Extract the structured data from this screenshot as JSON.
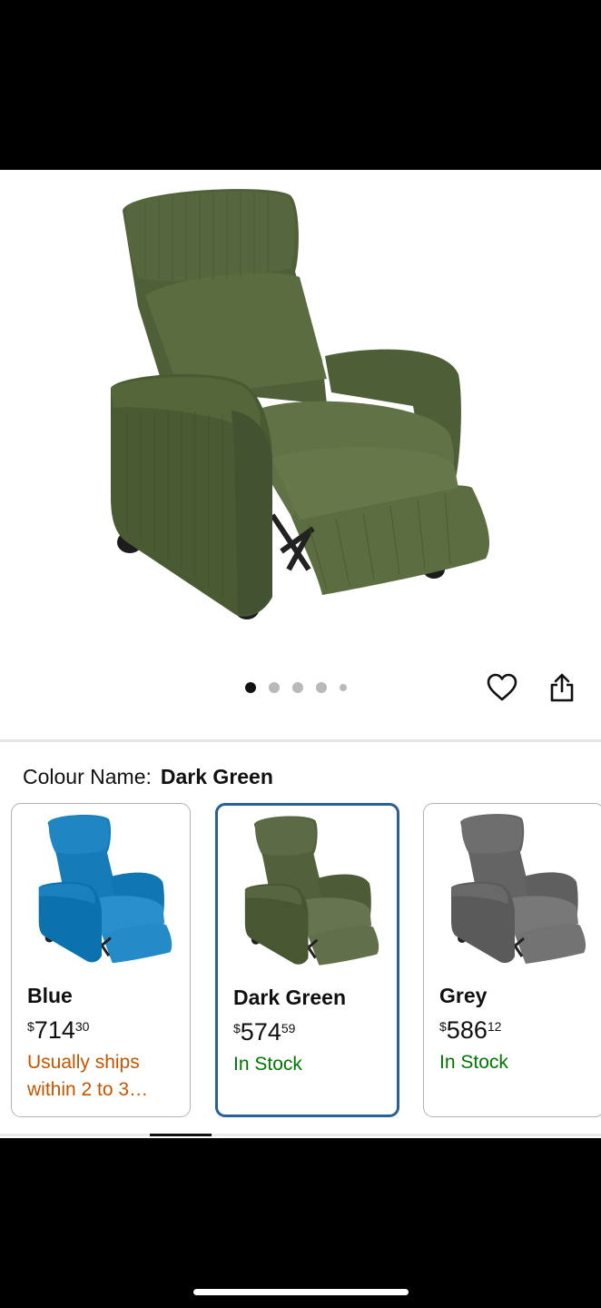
{
  "product": {
    "image_count": 5,
    "active_image": 1
  },
  "icons": {
    "wishlist": "heart-outline-icon",
    "share": "share-icon"
  },
  "variation": {
    "label": "Colour Name:",
    "selected": "Dark Green"
  },
  "swatches": [
    {
      "name": "Blue",
      "currency": "$",
      "price_whole": "714",
      "price_fraction": "30",
      "availability": "Usually ships within 2 to 3…",
      "availability_color": "#c45500",
      "chair_color": "#1f86c2",
      "selected": false
    },
    {
      "name": "Dark Green",
      "currency": "$",
      "price_whole": "574",
      "price_fraction": "59",
      "availability": "In Stock",
      "availability_color": "#007600",
      "chair_color": "#5c6b45",
      "selected": true
    },
    {
      "name": "Grey",
      "currency": "$",
      "price_whole": "586",
      "price_fraction": "12",
      "availability": "In Stock",
      "availability_color": "#007600",
      "chair_color": "#6e6e6e",
      "selected": false
    }
  ],
  "colors": {
    "selected_border": "#2a5f98",
    "main_chair": "#5a6a40"
  }
}
